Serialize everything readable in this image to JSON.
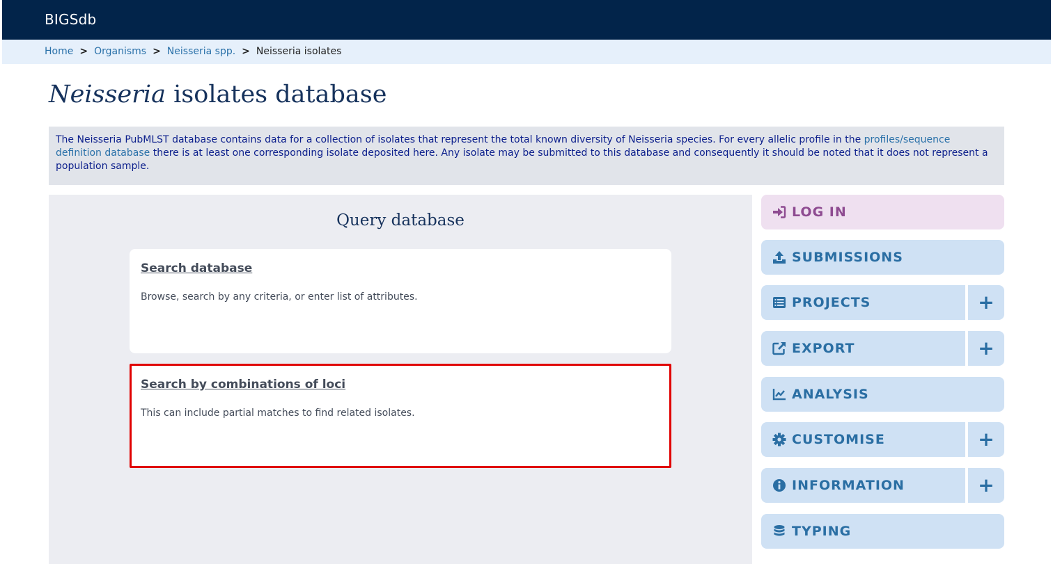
{
  "header": {
    "brand": "BIGSdb"
  },
  "breadcrumb": {
    "items": [
      "Home",
      "Organisms",
      "Neisseria spp."
    ],
    "separator": ">",
    "current": "Neisseria isolates"
  },
  "title": {
    "genus": "Neisseria",
    "rest": "isolates database"
  },
  "description": {
    "before_link": "The Neisseria PubMLST database contains data for a collection of isolates that represent the total known diversity of Neisseria species. For every allelic profile in the ",
    "link": "profiles/sequence definition database",
    "after_link": " there is at least one corresponding isolate deposited here. Any isolate may be submitted to this database and consequently it should be noted that it does not represent a population sample."
  },
  "query": {
    "title": "Query database",
    "cards": [
      {
        "title": "Search database",
        "desc": "Browse, search by any criteria, or enter list of attributes."
      },
      {
        "title": "Search by combinations of loci",
        "desc": "This can include partial matches to find related isolates."
      }
    ]
  },
  "menu": {
    "items": [
      {
        "label": "LOG IN",
        "icon": "sign-in-icon"
      },
      {
        "label": "SUBMISSIONS",
        "icon": "upload-icon"
      },
      {
        "label": "PROJECTS",
        "icon": "list-icon",
        "expand": "+"
      },
      {
        "label": "EXPORT",
        "icon": "external-link-icon",
        "expand": "+"
      },
      {
        "label": "ANALYSIS",
        "icon": "chart-line-icon"
      },
      {
        "label": "CUSTOMISE",
        "icon": "gear-icon",
        "expand": "+"
      },
      {
        "label": "INFORMATION",
        "icon": "info-circle-icon",
        "expand": "+"
      },
      {
        "label": "TYPING",
        "icon": "database-icon"
      }
    ]
  },
  "colors": {
    "header_bg": "#02244a",
    "breadcrumb_bg": "#e6f0fb",
    "link": "#2a71a9",
    "menu_bg": "#cfe1f4",
    "login_bg": "#efe0f0",
    "highlight": "#e00000"
  }
}
